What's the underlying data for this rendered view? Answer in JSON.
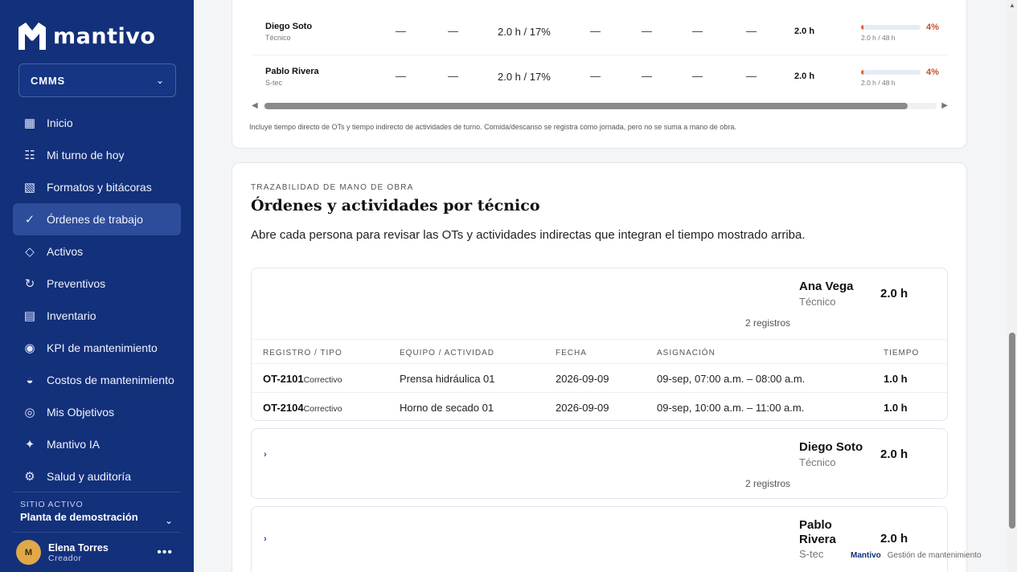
{
  "app": {
    "name": "mantivo"
  },
  "sidebar": {
    "module": "CMMS",
    "items": [
      {
        "label": "Inicio",
        "icon": "grid-icon",
        "glyph": "▦"
      },
      {
        "label": "Mi turno de hoy",
        "icon": "checklist-icon",
        "glyph": "☷"
      },
      {
        "label": "Formatos y bitácoras",
        "icon": "forms-icon",
        "glyph": "▧"
      },
      {
        "label": "Órdenes de trabajo",
        "icon": "check-icon",
        "glyph": "✓",
        "active": true
      },
      {
        "label": "Activos",
        "icon": "diamond-icon",
        "glyph": "◇"
      },
      {
        "label": "Preventivos",
        "icon": "refresh-icon",
        "glyph": "↻"
      },
      {
        "label": "Inventario",
        "icon": "inventory-icon",
        "glyph": "▤"
      },
      {
        "label": "KPI de mantenimiento",
        "icon": "target-icon",
        "glyph": "◉"
      },
      {
        "label": "Costos de mantenimiento",
        "icon": "half-circle-icon",
        "glyph": "◒"
      },
      {
        "label": "Mis Objetivos",
        "icon": "objective-icon",
        "glyph": "◎"
      },
      {
        "label": "Mantivo IA",
        "icon": "sparkle-icon",
        "glyph": "✦"
      },
      {
        "label": "Salud y auditoría",
        "icon": "settings-icon",
        "glyph": "⚙"
      }
    ],
    "site": {
      "label": "SITIO ACTIVO",
      "value": "Planta de demostración"
    },
    "user": {
      "initial": "M",
      "name": "Elena Torres",
      "role": "Creador"
    }
  },
  "utilization": {
    "rows": [
      {
        "name": "Diego Soto",
        "role": "Técnico",
        "dash": "—",
        "mid": "2.0 h / 17%",
        "total": "2.0 h",
        "bar_fraction": 0.04,
        "bar_text": "2.0 h / 48 h",
        "pct": "4%"
      },
      {
        "name": "Pablo Rivera",
        "role": "S-tec",
        "dash": "—",
        "mid": "2.0 h / 17%",
        "total": "2.0 h",
        "bar_fraction": 0.04,
        "bar_text": "2.0 h / 48 h",
        "pct": "4%"
      }
    ],
    "note": "Incluye tiempo directo de OTs y tiempo indirecto de actividades de turno. Comida/descanso se registra como jornada, pero no se suma a mano de obra."
  },
  "traceability": {
    "eyebrow": "TRAZABILIDAD DE MANO DE OBRA",
    "title": "Órdenes y actividades por técnico",
    "lead": "Abre cada persona para revisar las OTs y actividades indirectas que integran el tiempo mostrado arriba.",
    "columns": [
      "REGISTRO / TIPO",
      "EQUIPO / ACTIVIDAD",
      "FECHA",
      "ASIGNACIÓN",
      "TIEMPO"
    ],
    "people": [
      {
        "name": "Ana Vega",
        "role": "Técnico",
        "hours": "2.0 h",
        "records": "2 registros",
        "rows": [
          {
            "code": "OT-2101",
            "type": "Correctivo",
            "equipment": "Prensa hidráulica 01",
            "date": "2026-09-09",
            "assignment": "09-sep, 07:00 a.m. – 08:00 a.m.",
            "time": "1.0 h"
          },
          {
            "code": "OT-2104",
            "type": "Correctivo",
            "equipment": "Horno de secado 01",
            "date": "2026-09-09",
            "assignment": "09-sep, 10:00 a.m. – 11:00 a.m.",
            "time": "1.0 h"
          }
        ]
      },
      {
        "name": "Diego Soto",
        "role": "Técnico",
        "hours": "2.0 h",
        "records": "2 registros",
        "toggle": "›"
      },
      {
        "name": "Pablo Rivera",
        "role": "S-tec",
        "hours": "2.0 h",
        "toggle": "›"
      }
    ]
  },
  "footer": {
    "brand": "Mantivo",
    "tagline": "Gestión de mantenimiento"
  }
}
